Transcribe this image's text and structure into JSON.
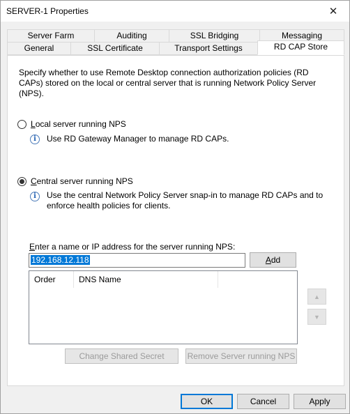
{
  "window": {
    "title": "SERVER-1 Properties",
    "close_glyph": "✕"
  },
  "tabs": {
    "row_back": [
      "Server Farm",
      "Auditing",
      "SSL Bridging",
      "Messaging"
    ],
    "row_front": [
      "General",
      "SSL Certificate",
      "Transport Settings",
      "RD CAP Store"
    ],
    "active": "RD CAP Store"
  },
  "panel": {
    "description": "Specify whether to use Remote Desktop connection authorization policies (RD CAPs) stored on the local or central server that is running Network Policy Server (NPS).",
    "local_option": {
      "label_first": "L",
      "label_rest": "ocal server running NPS",
      "selected": false,
      "info": "Use RD Gateway Manager to manage RD CAPs."
    },
    "central_option": {
      "label_first": "C",
      "label_rest": "entral server running NPS",
      "selected": true,
      "info_line1": "Use the central Network Policy Server snap-in to manage RD CAPs and to",
      "info_line2": "enforce health policies for clients."
    },
    "input_label_before": "E",
    "input_label_after": "nter a name or IP address for the server running NPS:",
    "input_value": "192.168.12.118",
    "add_button_first": "A",
    "add_button_rest": "dd",
    "list_columns": [
      "Order",
      "DNS Name"
    ],
    "change_secret_label": "Change Shared Secret",
    "remove_server_label": "Remove Server running NPS"
  },
  "footer": {
    "ok": "OK",
    "cancel": "Cancel",
    "apply": "Apply"
  },
  "icons": {
    "info": "info-icon",
    "up": "arrow-up-icon",
    "down": "arrow-down-icon"
  },
  "colors": {
    "selection": "#0078d7",
    "default_button_border": "#0078d7"
  }
}
